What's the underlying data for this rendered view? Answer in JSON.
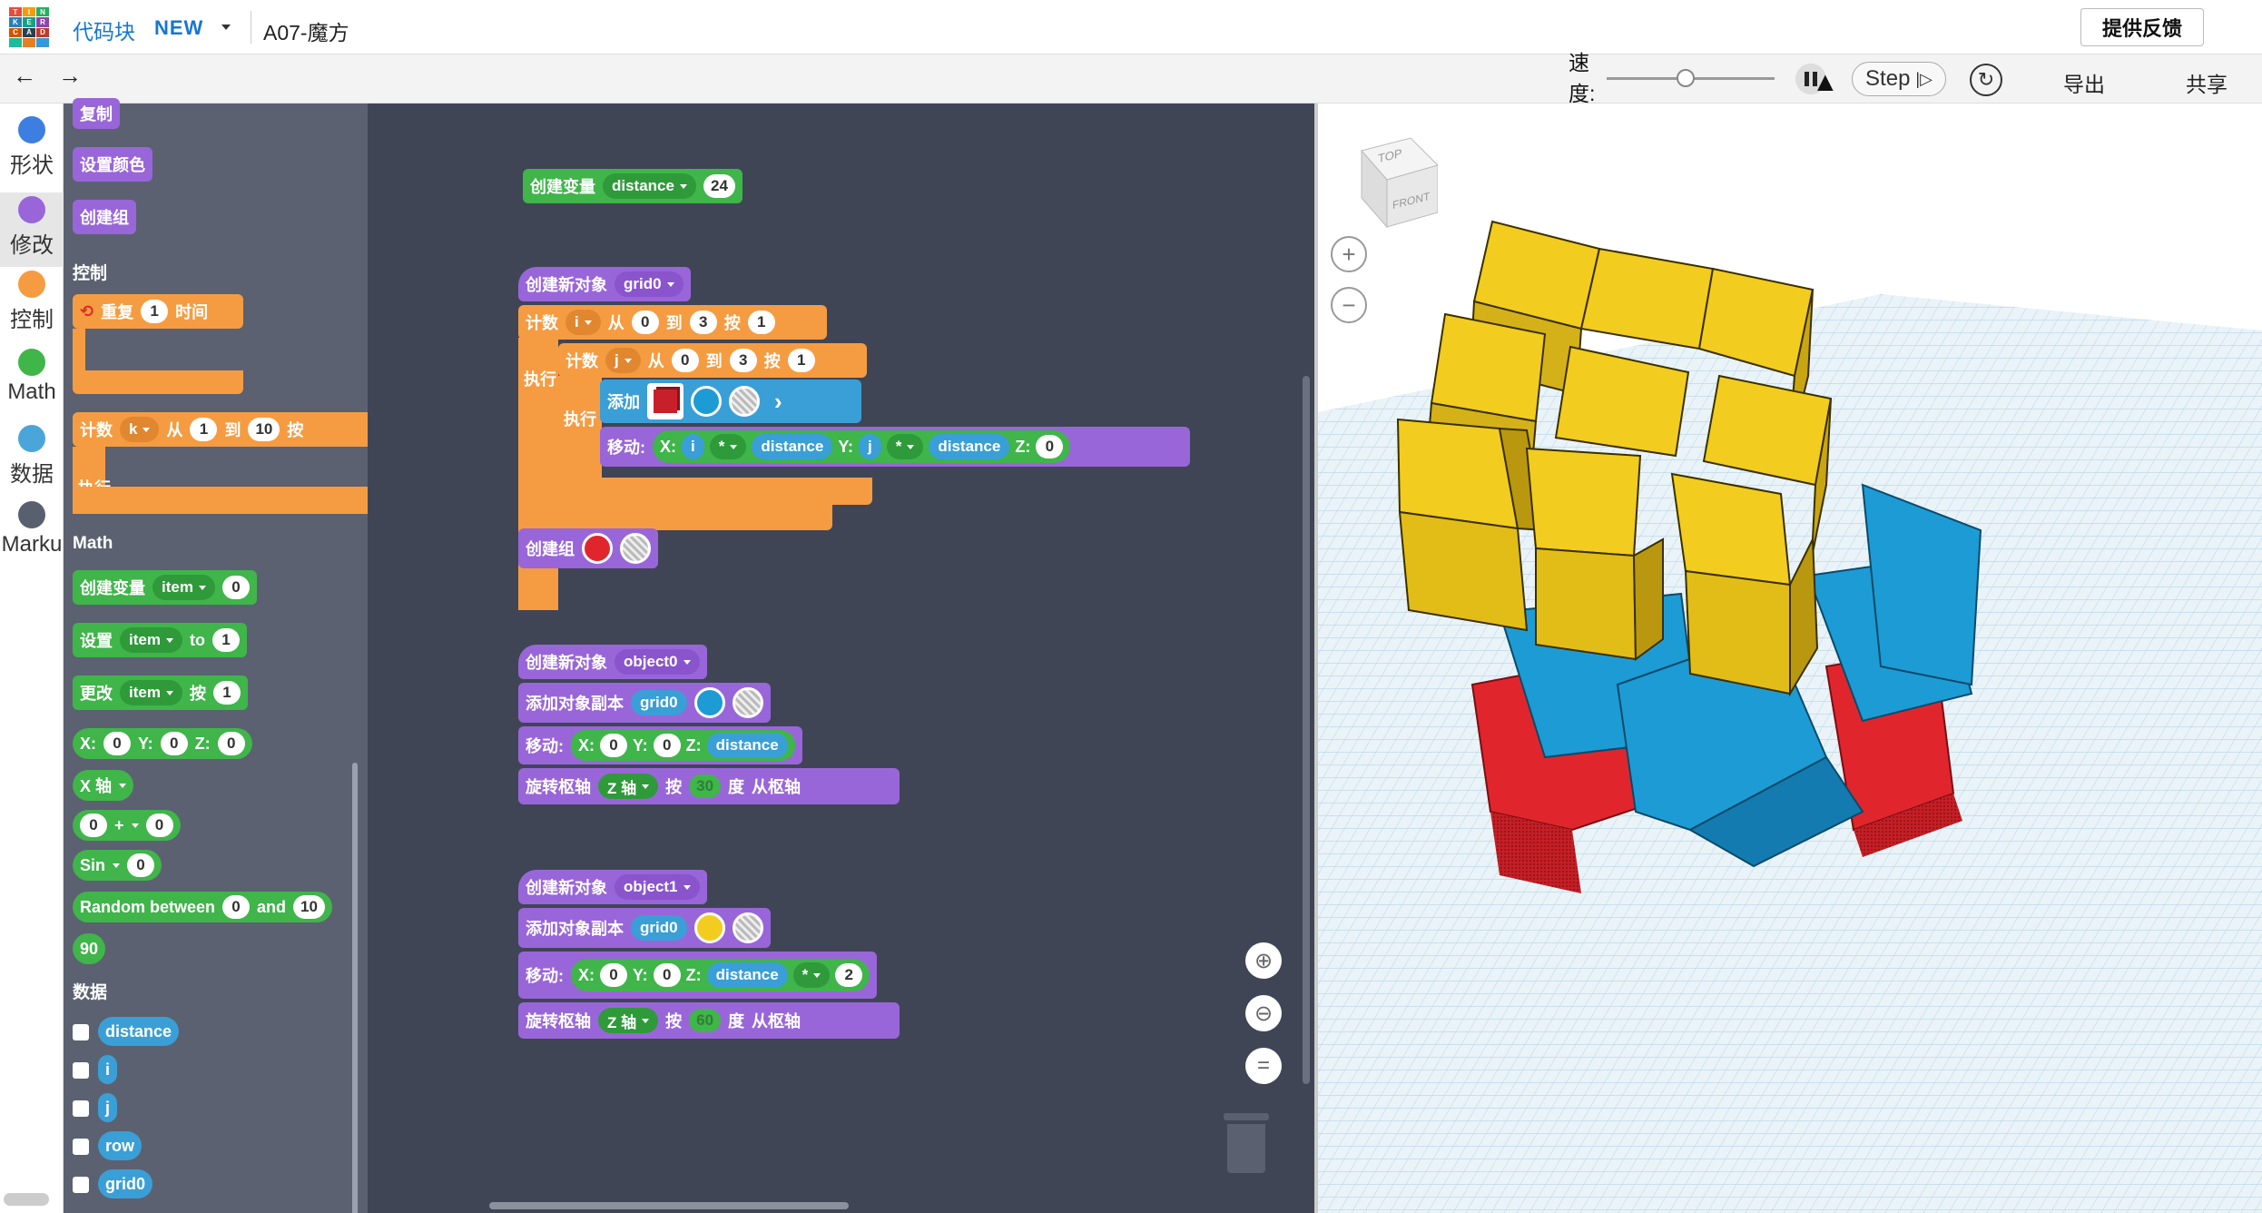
{
  "header": {
    "logo_letters": [
      "T",
      "I",
      "N",
      "K",
      "E",
      "R",
      "C",
      "A",
      "D",
      "",
      "",
      ""
    ],
    "app_name": "代码块",
    "new_badge": "NEW",
    "doc_title": "A07-魔方",
    "feedback_label": "提供反馈"
  },
  "toolbar": {
    "undo_icon": "undo-icon",
    "redo_icon": "redo-icon",
    "speed_label": "速度:",
    "speed_level": 0.47,
    "step_label": "Step",
    "export_label": "导出",
    "share_label": "共享"
  },
  "categories": [
    {
      "label": "形状",
      "color": "#3d7fe0"
    },
    {
      "label": "修改",
      "color": "#9966d9"
    },
    {
      "label": "控制",
      "color": "#f59c42"
    },
    {
      "label": "Math",
      "color": "#3fb54a"
    },
    {
      "label": "数据",
      "color": "#4aa6d8"
    },
    {
      "label": "Marku",
      "color": "#586070"
    }
  ],
  "flyout": {
    "copy": "复制",
    "set_color": "设置颜色",
    "create_group": "创建组",
    "control_title": "控制",
    "repeat": "重复",
    "repeat_n": "1",
    "times": "时间",
    "count": "计数",
    "count_var": "k",
    "from": "从",
    "from_v": "1",
    "to": "到",
    "to_v": "10",
    "by": "按",
    "do": "执行",
    "math_title": "Math",
    "create_var": "创建变量",
    "var_item": "item",
    "zero": "0",
    "set": "设置",
    "to_en": "to",
    "one": "1",
    "change": "更改",
    "x": "X:",
    "y": "Y:",
    "z": "Z:",
    "x_axis": "X 轴",
    "plus": "+",
    "sin": "Sin",
    "random_between": "Random between",
    "and": "and",
    "rand_hi": "10",
    "ninety": "90",
    "data_title": "数据",
    "vars": [
      "distance",
      "i",
      "j",
      "row",
      "grid0"
    ]
  },
  "workspace": {
    "create_var": "创建变量",
    "var_distance": "distance",
    "distance_value": "24",
    "create_object": "创建新对象",
    "grid0": "grid0",
    "count": "计数",
    "var_i": "i",
    "var_j": "j",
    "from": "从",
    "to": "到",
    "by": "按",
    "zero": "0",
    "three": "3",
    "one": "1",
    "do": "执行",
    "add": "添加",
    "move": "移动:",
    "x": "X:",
    "y": "Y:",
    "z": "Z:",
    "mult": "*",
    "create_group": "创建组",
    "object0": "object0",
    "object1": "object1",
    "add_copy": "添加对象副本",
    "rotate": "旋转枢轴",
    "z_axis": "Z 轴",
    "deg_30": "30",
    "deg_60": "60",
    "degree": "度",
    "from_axis": "从枢轴",
    "two": "2"
  },
  "viewport": {
    "cube_top": "TOP",
    "cube_front": "FRONT",
    "zoom_in": "+",
    "zoom_out": "−"
  },
  "colors": {
    "yellow": "#f2cc1f",
    "blue": "#1d9bd4",
    "red": "#e0262c",
    "grid": "#cfe3ef"
  }
}
